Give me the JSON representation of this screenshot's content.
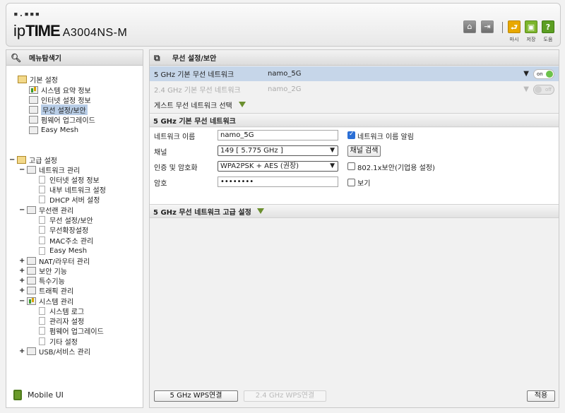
{
  "header": {
    "logo_dots": "▪.▪▪▪",
    "logo_ip": "ip",
    "logo_time": "TIME",
    "model": "A3004NS-M",
    "actions": [
      {
        "label": "마시",
        "color": "#e8a800",
        "icon": "exit-icon"
      },
      {
        "label": "저장",
        "color": "#7cb52b",
        "icon": "save-icon"
      },
      {
        "label": "도움",
        "color": "#5b9e22",
        "icon": "help-icon"
      }
    ]
  },
  "left": {
    "title": "메뉴탐색기",
    "mobile": "Mobile UI",
    "basic": {
      "label": "기본 설정",
      "items": [
        "시스템 요약 정보",
        "인터넷 설정 정보",
        "무선 설정/보안",
        "펌웨어 업그레이드",
        "Easy Mesh"
      ]
    },
    "advanced": {
      "label": "고급 설정",
      "network": {
        "label": "네트워크 관리",
        "items": [
          "인터넷 설정 정보",
          "내부 네트워크 설정",
          "DHCP 서버 설정"
        ]
      },
      "wireless": {
        "label": "무선랜 관리",
        "items": [
          "무선 설정/보안",
          "무선확장설정",
          "MAC주소 관리",
          "Easy Mesh"
        ]
      },
      "nat": "NAT/라우터 관리",
      "security": "보안 기능",
      "special": "특수기능",
      "traffic": "트래픽 관리",
      "system": {
        "label": "시스템 관리",
        "items": [
          "시스템 로그",
          "관리자 설정",
          "펌웨어 업그레이드",
          "기타 설정"
        ]
      },
      "usb": "USB/서비스 관리"
    }
  },
  "right": {
    "title": "무선 설정/보안",
    "networks": [
      {
        "label": "5 GHz 기본 무선 네트워크",
        "ssid": "namo_5G",
        "toggle": "on",
        "enabled": true
      },
      {
        "label": "2.4 GHz 기본 무선 네트워크",
        "ssid": "namo_2G",
        "toggle": "off",
        "enabled": false
      }
    ],
    "guest": "게스트 무선 네트워크 선택",
    "section5g": "5 GHz 기본 무선 네트워크",
    "form": {
      "name_label": "네트워크 이름",
      "name_value": "namo_5G",
      "broadcast_label": "네트워크 이름 알림",
      "channel_label": "채널",
      "channel_value": "149 [ 5.775 GHz ]",
      "scan_button": "채널 검색",
      "auth_label": "인증 및 암호화",
      "auth_value": "WPA2PSK + AES (권장)",
      "enterprise_label": "802.1x보안(기업용 설정)",
      "password_label": "암호",
      "password_value": "••••••••",
      "show_label": "보기"
    },
    "advanced": "5 GHz 무선 네트워크 고급 설정",
    "wps5": "5 GHz WPS연결",
    "wps24": "2.4 GHz WPS연결",
    "apply": "적용"
  }
}
